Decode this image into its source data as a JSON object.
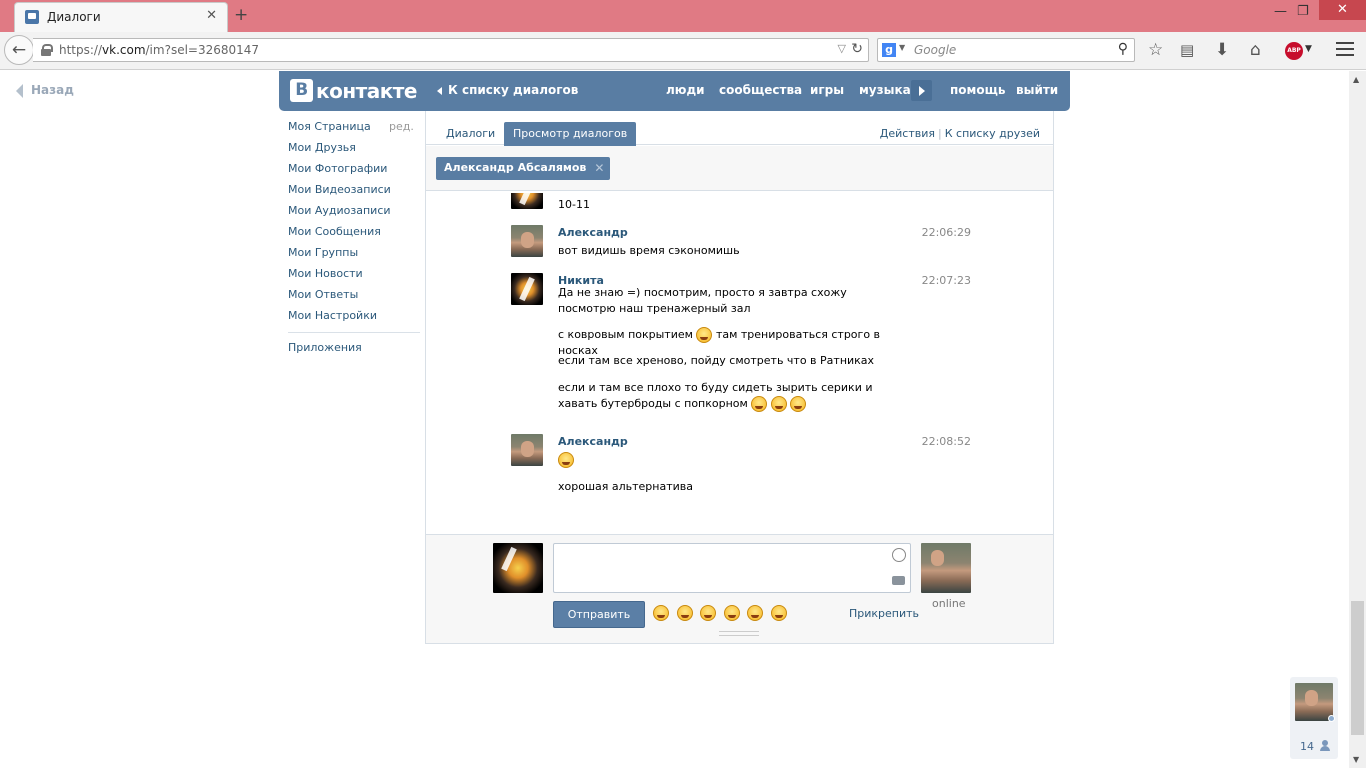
{
  "browser": {
    "tab_title": "Диалоги",
    "tab_close": "✕",
    "new_tab": "+",
    "win_min": "—",
    "win_max": "❐",
    "win_close": "✕",
    "url_prefix": "https://",
    "url_host": "vk.com",
    "url_path": "/im?sel=32680147",
    "search_engine_letter": "g",
    "search_placeholder": "Google",
    "abp_label": "ABP"
  },
  "vk": {
    "back_label": "Назад",
    "logo_letter": "В",
    "logo_text": "контакте",
    "to_dialogs": "К списку диалогов",
    "nav": [
      "люди",
      "сообщества",
      "игры",
      "музыка",
      "помощь",
      "выйти"
    ],
    "left_menu": [
      "Моя Страница",
      "Мои Друзья",
      "Мои Фотографии",
      "Мои Видеозаписи",
      "Мои Аудиозаписи",
      "Мои Сообщения",
      "Мои Группы",
      "Мои Новости",
      "Мои Ответы",
      "Мои Настройки"
    ],
    "edit_label": "ред.",
    "apps_label": "Приложения",
    "tabs": [
      "Диалоги",
      "Просмотр диалогов"
    ],
    "actions_label": "Действия",
    "to_friends_label": "К списку друзей",
    "actions_sep": "|",
    "peer_name": "Александр Абсалямов",
    "peer_close": "✕",
    "messages": {
      "m0": {
        "text": "10-11"
      },
      "m1": {
        "author": "Александр",
        "time": "22:06:29",
        "text": "вот видишь время сэкономишь"
      },
      "m2": {
        "author": "Никита",
        "time": "22:07:23",
        "lines": [
          "Да не знаю =) посмотрим, просто я завтра схожу посмотрю наш тренажерный зал",
          "с ковровым покрытием",
          "там тренироваться строго в носках",
          "если там все хреново, пойду смотреть что в Ратниках",
          "если и там все плохо то буду сидеть зырить серики и хавать бутерброды с попкорном"
        ]
      },
      "m3": {
        "author": "Александр",
        "time": "22:08:52",
        "text": "хорошая альтернатива"
      }
    },
    "send_label": "Отправить",
    "attach_label": "Прикрепить",
    "online_label": "online",
    "friends_count": "14"
  }
}
